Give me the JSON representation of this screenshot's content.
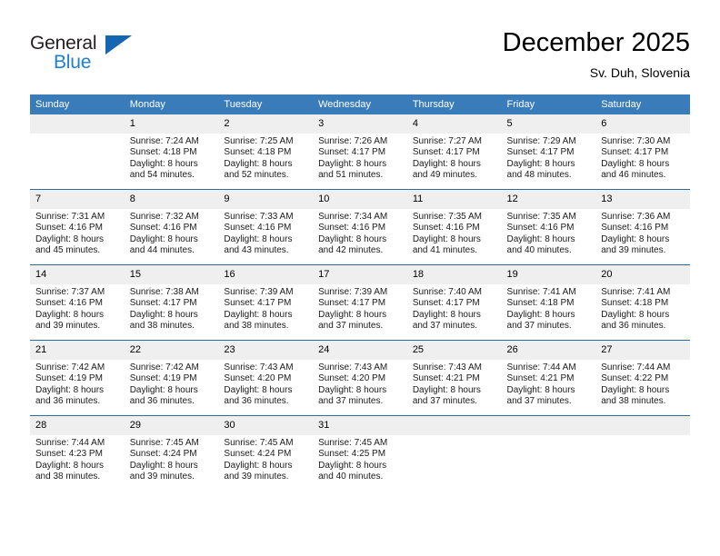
{
  "brand": {
    "word_one": "General",
    "word_two": "Blue",
    "triangle_icon": "triangle-icon"
  },
  "header": {
    "month_title": "December 2025",
    "location": "Sv. Duh, Slovenia"
  },
  "colors": {
    "header_blue": "#3a7cba",
    "row_border_blue": "#2b6ca3",
    "daynum_strip": "#efefef",
    "brand_blue": "#1f7fd0",
    "brand_dark": "#231f20"
  },
  "calendar": {
    "weekday_headers": [
      "Sunday",
      "Monday",
      "Tuesday",
      "Wednesday",
      "Thursday",
      "Friday",
      "Saturday"
    ],
    "weeks": [
      [
        {
          "day": "",
          "empty": true,
          "sunrise": "",
          "sunset": "",
          "daylight_line1": "",
          "daylight_line2": ""
        },
        {
          "day": "1",
          "empty": false,
          "sunrise": "Sunrise: 7:24 AM",
          "sunset": "Sunset: 4:18 PM",
          "daylight_line1": "Daylight: 8 hours",
          "daylight_line2": "and 54 minutes."
        },
        {
          "day": "2",
          "empty": false,
          "sunrise": "Sunrise: 7:25 AM",
          "sunset": "Sunset: 4:18 PM",
          "daylight_line1": "Daylight: 8 hours",
          "daylight_line2": "and 52 minutes."
        },
        {
          "day": "3",
          "empty": false,
          "sunrise": "Sunrise: 7:26 AM",
          "sunset": "Sunset: 4:17 PM",
          "daylight_line1": "Daylight: 8 hours",
          "daylight_line2": "and 51 minutes."
        },
        {
          "day": "4",
          "empty": false,
          "sunrise": "Sunrise: 7:27 AM",
          "sunset": "Sunset: 4:17 PM",
          "daylight_line1": "Daylight: 8 hours",
          "daylight_line2": "and 49 minutes."
        },
        {
          "day": "5",
          "empty": false,
          "sunrise": "Sunrise: 7:29 AM",
          "sunset": "Sunset: 4:17 PM",
          "daylight_line1": "Daylight: 8 hours",
          "daylight_line2": "and 48 minutes."
        },
        {
          "day": "6",
          "empty": false,
          "sunrise": "Sunrise: 7:30 AM",
          "sunset": "Sunset: 4:17 PM",
          "daylight_line1": "Daylight: 8 hours",
          "daylight_line2": "and 46 minutes."
        }
      ],
      [
        {
          "day": "7",
          "empty": false,
          "sunrise": "Sunrise: 7:31 AM",
          "sunset": "Sunset: 4:16 PM",
          "daylight_line1": "Daylight: 8 hours",
          "daylight_line2": "and 45 minutes."
        },
        {
          "day": "8",
          "empty": false,
          "sunrise": "Sunrise: 7:32 AM",
          "sunset": "Sunset: 4:16 PM",
          "daylight_line1": "Daylight: 8 hours",
          "daylight_line2": "and 44 minutes."
        },
        {
          "day": "9",
          "empty": false,
          "sunrise": "Sunrise: 7:33 AM",
          "sunset": "Sunset: 4:16 PM",
          "daylight_line1": "Daylight: 8 hours",
          "daylight_line2": "and 43 minutes."
        },
        {
          "day": "10",
          "empty": false,
          "sunrise": "Sunrise: 7:34 AM",
          "sunset": "Sunset: 4:16 PM",
          "daylight_line1": "Daylight: 8 hours",
          "daylight_line2": "and 42 minutes."
        },
        {
          "day": "11",
          "empty": false,
          "sunrise": "Sunrise: 7:35 AM",
          "sunset": "Sunset: 4:16 PM",
          "daylight_line1": "Daylight: 8 hours",
          "daylight_line2": "and 41 minutes."
        },
        {
          "day": "12",
          "empty": false,
          "sunrise": "Sunrise: 7:35 AM",
          "sunset": "Sunset: 4:16 PM",
          "daylight_line1": "Daylight: 8 hours",
          "daylight_line2": "and 40 minutes."
        },
        {
          "day": "13",
          "empty": false,
          "sunrise": "Sunrise: 7:36 AM",
          "sunset": "Sunset: 4:16 PM",
          "daylight_line1": "Daylight: 8 hours",
          "daylight_line2": "and 39 minutes."
        }
      ],
      [
        {
          "day": "14",
          "empty": false,
          "sunrise": "Sunrise: 7:37 AM",
          "sunset": "Sunset: 4:16 PM",
          "daylight_line1": "Daylight: 8 hours",
          "daylight_line2": "and 39 minutes."
        },
        {
          "day": "15",
          "empty": false,
          "sunrise": "Sunrise: 7:38 AM",
          "sunset": "Sunset: 4:17 PM",
          "daylight_line1": "Daylight: 8 hours",
          "daylight_line2": "and 38 minutes."
        },
        {
          "day": "16",
          "empty": false,
          "sunrise": "Sunrise: 7:39 AM",
          "sunset": "Sunset: 4:17 PM",
          "daylight_line1": "Daylight: 8 hours",
          "daylight_line2": "and 38 minutes."
        },
        {
          "day": "17",
          "empty": false,
          "sunrise": "Sunrise: 7:39 AM",
          "sunset": "Sunset: 4:17 PM",
          "daylight_line1": "Daylight: 8 hours",
          "daylight_line2": "and 37 minutes."
        },
        {
          "day": "18",
          "empty": false,
          "sunrise": "Sunrise: 7:40 AM",
          "sunset": "Sunset: 4:17 PM",
          "daylight_line1": "Daylight: 8 hours",
          "daylight_line2": "and 37 minutes."
        },
        {
          "day": "19",
          "empty": false,
          "sunrise": "Sunrise: 7:41 AM",
          "sunset": "Sunset: 4:18 PM",
          "daylight_line1": "Daylight: 8 hours",
          "daylight_line2": "and 37 minutes."
        },
        {
          "day": "20",
          "empty": false,
          "sunrise": "Sunrise: 7:41 AM",
          "sunset": "Sunset: 4:18 PM",
          "daylight_line1": "Daylight: 8 hours",
          "daylight_line2": "and 36 minutes."
        }
      ],
      [
        {
          "day": "21",
          "empty": false,
          "sunrise": "Sunrise: 7:42 AM",
          "sunset": "Sunset: 4:19 PM",
          "daylight_line1": "Daylight: 8 hours",
          "daylight_line2": "and 36 minutes."
        },
        {
          "day": "22",
          "empty": false,
          "sunrise": "Sunrise: 7:42 AM",
          "sunset": "Sunset: 4:19 PM",
          "daylight_line1": "Daylight: 8 hours",
          "daylight_line2": "and 36 minutes."
        },
        {
          "day": "23",
          "empty": false,
          "sunrise": "Sunrise: 7:43 AM",
          "sunset": "Sunset: 4:20 PM",
          "daylight_line1": "Daylight: 8 hours",
          "daylight_line2": "and 36 minutes."
        },
        {
          "day": "24",
          "empty": false,
          "sunrise": "Sunrise: 7:43 AM",
          "sunset": "Sunset: 4:20 PM",
          "daylight_line1": "Daylight: 8 hours",
          "daylight_line2": "and 37 minutes."
        },
        {
          "day": "25",
          "empty": false,
          "sunrise": "Sunrise: 7:43 AM",
          "sunset": "Sunset: 4:21 PM",
          "daylight_line1": "Daylight: 8 hours",
          "daylight_line2": "and 37 minutes."
        },
        {
          "day": "26",
          "empty": false,
          "sunrise": "Sunrise: 7:44 AM",
          "sunset": "Sunset: 4:21 PM",
          "daylight_line1": "Daylight: 8 hours",
          "daylight_line2": "and 37 minutes."
        },
        {
          "day": "27",
          "empty": false,
          "sunrise": "Sunrise: 7:44 AM",
          "sunset": "Sunset: 4:22 PM",
          "daylight_line1": "Daylight: 8 hours",
          "daylight_line2": "and 38 minutes."
        }
      ],
      [
        {
          "day": "28",
          "empty": false,
          "sunrise": "Sunrise: 7:44 AM",
          "sunset": "Sunset: 4:23 PM",
          "daylight_line1": "Daylight: 8 hours",
          "daylight_line2": "and 38 minutes."
        },
        {
          "day": "29",
          "empty": false,
          "sunrise": "Sunrise: 7:45 AM",
          "sunset": "Sunset: 4:24 PM",
          "daylight_line1": "Daylight: 8 hours",
          "daylight_line2": "and 39 minutes."
        },
        {
          "day": "30",
          "empty": false,
          "sunrise": "Sunrise: 7:45 AM",
          "sunset": "Sunset: 4:24 PM",
          "daylight_line1": "Daylight: 8 hours",
          "daylight_line2": "and 39 minutes."
        },
        {
          "day": "31",
          "empty": false,
          "sunrise": "Sunrise: 7:45 AM",
          "sunset": "Sunset: 4:25 PM",
          "daylight_line1": "Daylight: 8 hours",
          "daylight_line2": "and 40 minutes."
        },
        {
          "day": "",
          "empty": true,
          "sunrise": "",
          "sunset": "",
          "daylight_line1": "",
          "daylight_line2": ""
        },
        {
          "day": "",
          "empty": true,
          "sunrise": "",
          "sunset": "",
          "daylight_line1": "",
          "daylight_line2": ""
        },
        {
          "day": "",
          "empty": true,
          "sunrise": "",
          "sunset": "",
          "daylight_line1": "",
          "daylight_line2": ""
        }
      ]
    ]
  }
}
